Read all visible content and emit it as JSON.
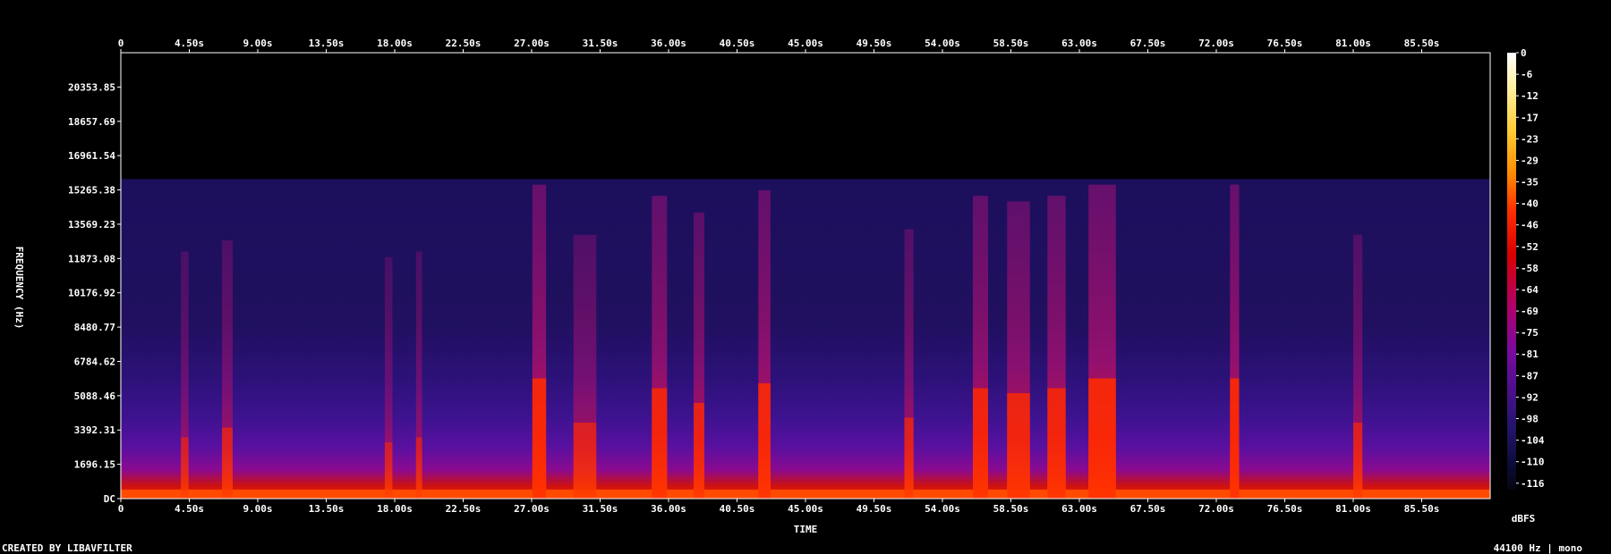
{
  "chart_data": {
    "type": "heatmap",
    "title": "",
    "xlabel": "TIME",
    "ylabel": "FREQUENCY (Hz)",
    "colorbar_label": "dBFS",
    "footer_left": "CREATED BY LIBAVFILTER",
    "footer_right": "44100 Hz | mono",
    "x_ticks": [
      "0",
      "4.50s",
      "9.00s",
      "13.50s",
      "18.00s",
      "22.50s",
      "27.00s",
      "31.50s",
      "36.00s",
      "40.50s",
      "45.00s",
      "49.50s",
      "54.00s",
      "58.50s",
      "63.00s",
      "67.50s",
      "72.00s",
      "76.50s",
      "81.00s",
      "85.50s"
    ],
    "y_ticks": [
      "DC",
      "1696.15",
      "3392.31",
      "5088.46",
      "6784.62",
      "8480.77",
      "10176.92",
      "11873.08",
      "13569.23",
      "15265.38",
      "16961.54",
      "18657.69",
      "20353.85"
    ],
    "colorbar_ticks": [
      "0",
      "-6",
      "-12",
      "-17",
      "-23",
      "-29",
      "-35",
      "-40",
      "-46",
      "-52",
      "-58",
      "-64",
      "-69",
      "-75",
      "-81",
      "-87",
      "-92",
      "-98",
      "-104",
      "-110",
      "-116"
    ],
    "xlim": [
      0,
      90
    ],
    "ylim": [
      0,
      22050
    ],
    "cutoff_hz": 15800,
    "bursts": [
      {
        "t": 4.2,
        "w": 0.5,
        "i": 0.35
      },
      {
        "t": 7.0,
        "w": 0.7,
        "i": 0.45
      },
      {
        "t": 17.6,
        "w": 0.5,
        "i": 0.3
      },
      {
        "t": 19.6,
        "w": 0.4,
        "i": 0.35
      },
      {
        "t": 27.5,
        "w": 0.9,
        "i": 0.95
      },
      {
        "t": 30.5,
        "w": 1.5,
        "i": 0.5
      },
      {
        "t": 35.4,
        "w": 1.0,
        "i": 0.85
      },
      {
        "t": 38.0,
        "w": 0.7,
        "i": 0.7
      },
      {
        "t": 42.3,
        "w": 0.8,
        "i": 0.9
      },
      {
        "t": 51.8,
        "w": 0.6,
        "i": 0.55
      },
      {
        "t": 56.5,
        "w": 1.0,
        "i": 0.85
      },
      {
        "t": 59.0,
        "w": 1.5,
        "i": 0.8
      },
      {
        "t": 61.5,
        "w": 1.2,
        "i": 0.85
      },
      {
        "t": 64.5,
        "w": 1.8,
        "i": 0.95
      },
      {
        "t": 73.2,
        "w": 0.6,
        "i": 0.95
      },
      {
        "t": 81.3,
        "w": 0.6,
        "i": 0.5
      }
    ],
    "colors": {
      "background": "#000000",
      "text": "#ffffff",
      "gradient": [
        "#ffffff",
        "#fff0a0",
        "#ffcc33",
        "#ff8800",
        "#ff3000",
        "#d90000",
        "#b0006a",
        "#7a0aa0",
        "#48108a",
        "#23146a",
        "#0c0c3a",
        "#050510"
      ]
    }
  }
}
